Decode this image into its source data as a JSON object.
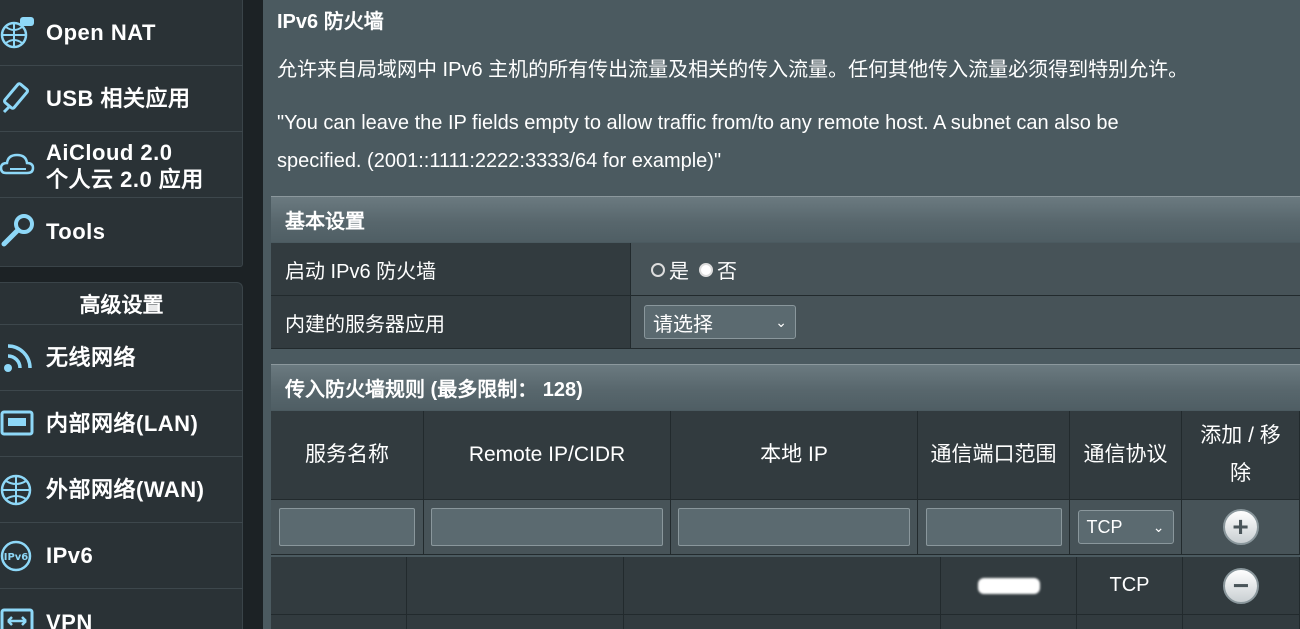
{
  "sidebar": {
    "general_items": [
      {
        "label": "Open NAT",
        "icon": "globe-gamepad-icon"
      },
      {
        "label": "USB 相关应用",
        "icon": "usb-icon"
      },
      {
        "label": "AiCloud 2.0",
        "label2": "个人云 2.0 应用",
        "icon": "cloud-icon"
      },
      {
        "label": "Tools",
        "icon": "wrench-icon"
      }
    ],
    "advanced_header": "高级设置",
    "advanced_items": [
      {
        "label": "无线网络",
        "icon": "wireless-icon"
      },
      {
        "label": "内部网络(LAN)",
        "icon": "lan-icon"
      },
      {
        "label": "外部网络(WAN)",
        "icon": "globe-icon"
      },
      {
        "label": "IPv6",
        "icon": "ipv6-icon"
      },
      {
        "label": "VPN",
        "icon": "vpn-icon"
      }
    ]
  },
  "page": {
    "title": "IPv6 防火墙",
    "desc1": "允许来自局域网中 IPv6 主机的所有传出流量及相关的传入流量。任何其他传入流量必须得到特别允许。",
    "desc2a": "\"You can leave the IP fields empty to allow traffic from/to any remote host. A subnet can also be",
    "desc2b": "specified. (2001::1111:2222:3333/64 for example)\""
  },
  "basic": {
    "header": "基本设置",
    "enable_label": "启动 IPv6 防火墙",
    "yes": "是",
    "no": "否",
    "selected": "no",
    "builtin_label": "内建的服务器应用",
    "builtin_value": "请选择"
  },
  "rules": {
    "header": "传入防火墙规则 (最多限制： 128)",
    "columns": [
      "服务名称",
      "Remote IP/CIDR",
      "本地 IP",
      "通信端口范围",
      "通信协议",
      "添加 / 移除"
    ],
    "new_protocol": "TCP",
    "rows": [
      {
        "name": "",
        "remote": "",
        "local": "",
        "port": "",
        "protocol": "TCP"
      }
    ]
  }
}
